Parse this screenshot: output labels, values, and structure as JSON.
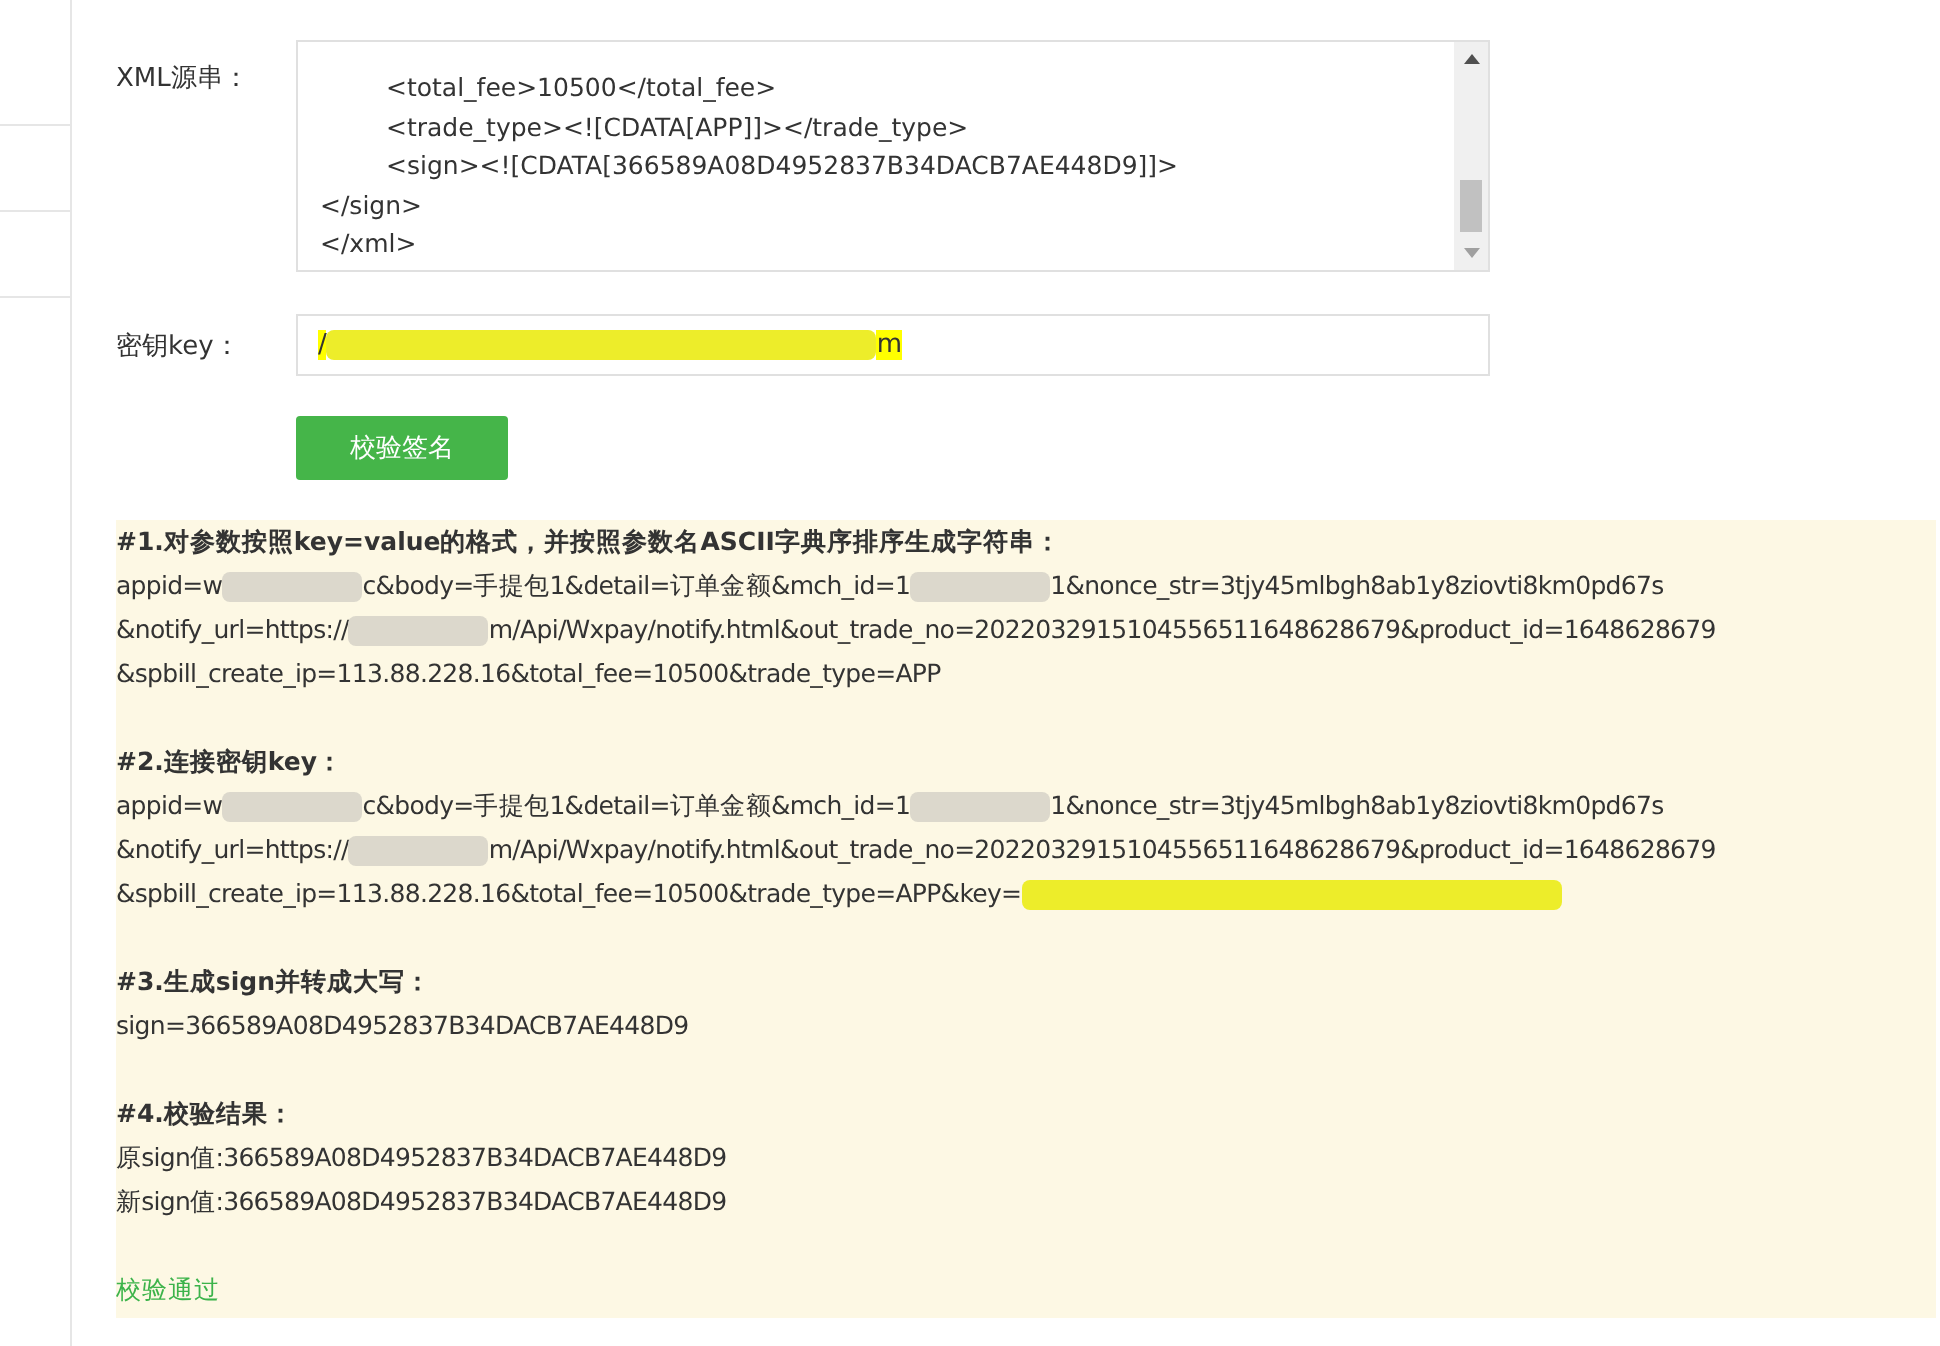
{
  "form": {
    "xml_label": "XML源串：",
    "xml_lines": [
      {
        "indent": true,
        "text": "<total_fee>10500</total_fee>"
      },
      {
        "indent": true,
        "text": "<trade_type><![CDATA[APP]]></trade_type>"
      },
      {
        "indent": true,
        "text": "<sign><![CDATA[366589A08D4952837B34DACB7AE448D9]]>"
      },
      {
        "indent": false,
        "text": "</sign>"
      },
      {
        "indent": false,
        "text": "</xml>"
      }
    ],
    "key_label": "密钥key：",
    "key_value": [
      {
        "kind": "text",
        "text": "/"
      },
      {
        "kind": "redaction",
        "color": "#eded2a"
      },
      {
        "kind": "text",
        "text": "m"
      }
    ],
    "verify_button": "校验签名"
  },
  "result": {
    "sections": [
      {
        "heading": "#1.对参数按照key=value的格式，并按照参数名ASCII字典序排序生成字符串：",
        "lines": [
          [
            {
              "kind": "text",
              "text": "appid=w"
            },
            {
              "kind": "redaction",
              "color": "#dcd8cc"
            },
            {
              "kind": "text",
              "text": "c&body=手提包1&detail=订单金额&mch_id=1"
            },
            {
              "kind": "redaction",
              "color": "#dcd8cc"
            },
            {
              "kind": "text",
              "text": "1&nonce_str=3tjy45mlbgh8ab1y8ziovti8km0pd67s"
            }
          ],
          [
            {
              "kind": "text",
              "text": "&notify_url=https://"
            },
            {
              "kind": "redaction",
              "color": "#dcd8cc"
            },
            {
              "kind": "text",
              "text": "m/Api/Wxpay/notify.html&out_trade_no=2022032915104556511648628679&product_id=1648628679"
            }
          ],
          [
            {
              "kind": "text",
              "text": "&spbill_create_ip=113.88.228.16&total_fee=10500&trade_type=APP"
            }
          ]
        ]
      },
      {
        "heading": "#2.连接密钥key：",
        "lines": [
          [
            {
              "kind": "text",
              "text": "appid=w"
            },
            {
              "kind": "redaction",
              "color": "#dcd8cc"
            },
            {
              "kind": "text",
              "text": "c&body=手提包1&detail=订单金额&mch_id=1"
            },
            {
              "kind": "redaction",
              "color": "#dcd8cc"
            },
            {
              "kind": "text",
              "text": "1&nonce_str=3tjy45mlbgh8ab1y8ziovti8km0pd67s"
            }
          ],
          [
            {
              "kind": "text",
              "text": "&notify_url=https://"
            },
            {
              "kind": "redaction",
              "color": "#dcd8cc"
            },
            {
              "kind": "text",
              "text": "m/Api/Wxpay/notify.html&out_trade_no=2022032915104556511648628679&product_id=1648628679"
            }
          ],
          [
            {
              "kind": "text",
              "text": "&spbill_create_ip=113.88.228.16&total_fee=10500&trade_type=APP&key="
            },
            {
              "kind": "redaction",
              "color": "#eded2a"
            }
          ]
        ]
      },
      {
        "heading": "#3.生成sign并转成大写：",
        "lines": [
          [
            {
              "kind": "text",
              "text": "sign=366589A08D4952837B34DACB7AE448D9"
            }
          ]
        ]
      },
      {
        "heading": "#4.校验结果：",
        "lines": [
          [
            {
              "kind": "text",
              "text": "原sign值:366589A08D4952837B34DACB7AE448D9"
            }
          ],
          [
            {
              "kind": "text",
              "text": "新sign值:366589A08D4952837B34DACB7AE448D9"
            }
          ]
        ]
      }
    ],
    "status": "校验通过"
  }
}
